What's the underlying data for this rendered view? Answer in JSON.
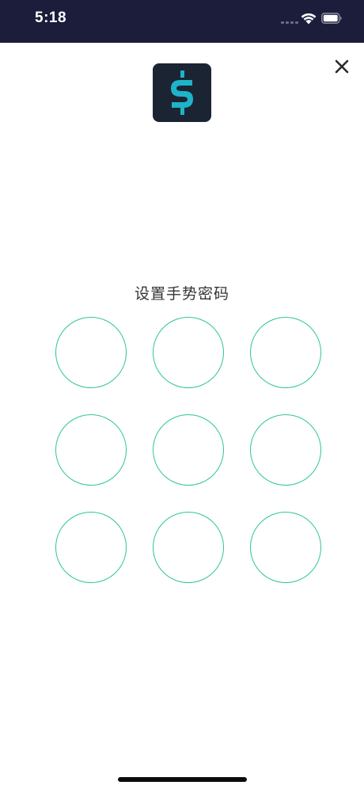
{
  "status_bar": {
    "time": "5:18",
    "wifi_icon": "wifi-icon",
    "battery_icon": "battery-icon",
    "background_color": "#1b1d3a"
  },
  "header": {
    "logo_icon": "dollar-sign-logo",
    "close_icon": "close-icon"
  },
  "gesture": {
    "title": "设置手势密码",
    "dot_count": 9,
    "accent_color": "#2ec59b"
  },
  "colors": {
    "logo_background": "#1b2433",
    "logo_dollar": "#1fb3c9",
    "title_text": "#333333"
  }
}
